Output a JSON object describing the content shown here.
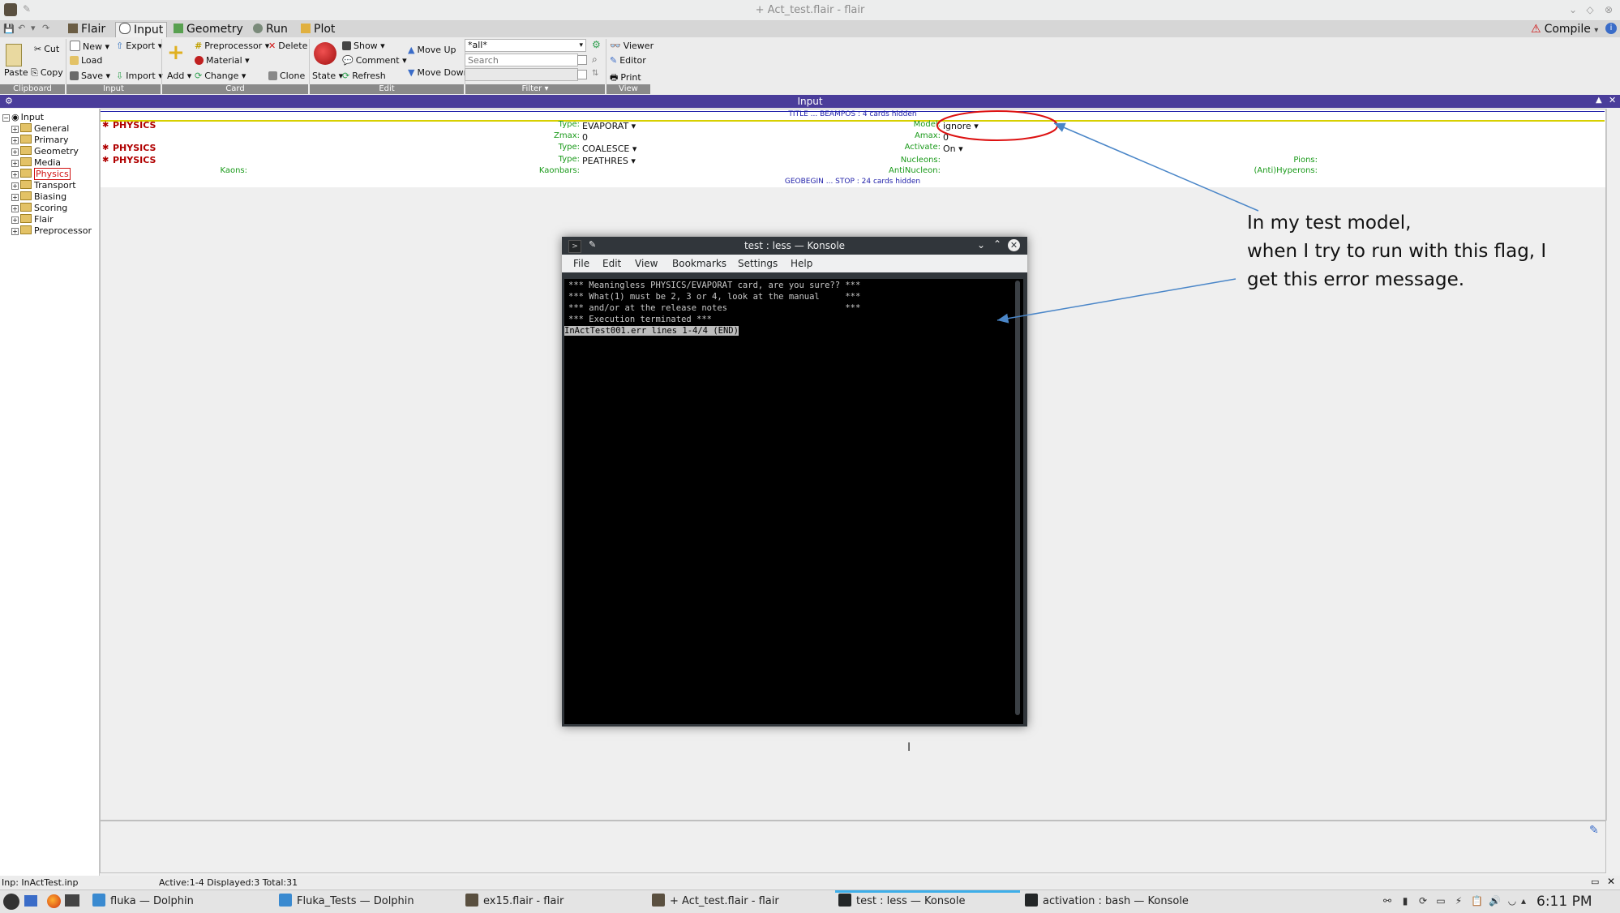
{
  "window": {
    "title": "+ Act_test.flair - flair"
  },
  "tabs": [
    {
      "label": "Flair",
      "active": false
    },
    {
      "label": "Input",
      "active": true
    },
    {
      "label": "Geometry",
      "active": false
    },
    {
      "label": "Run",
      "active": false
    },
    {
      "label": "Plot",
      "active": false
    }
  ],
  "compile_label": "Compile",
  "ribbon": {
    "clipboard": {
      "paste": "Paste",
      "cut": "Cut",
      "copy": "Copy",
      "group": "Clipboard"
    },
    "input": {
      "new": "New",
      "load": "Load",
      "save": "Save",
      "export": "Export",
      "import": "Import",
      "group": "Input"
    },
    "card": {
      "add": "Add",
      "preprocessor": "Preprocessor",
      "material": "Material",
      "change": "Change",
      "delete": "Delete",
      "clone": "Clone",
      "group": "Card"
    },
    "edit": {
      "state": "State",
      "show": "Show",
      "comment": "Comment",
      "refresh": "Refresh",
      "move_up": "Move Up",
      "move_down": "Move Down",
      "group": "Edit"
    },
    "filter": {
      "select_value": "*all*",
      "search_placeholder": "Search",
      "group": "Filter"
    },
    "view": {
      "viewer": "Viewer",
      "editor": "Editor",
      "print": "Print",
      "group": "View"
    }
  },
  "panel_title": "Input",
  "tree": {
    "root": "Input",
    "items": [
      "General",
      "Primary",
      "Geometry",
      "Media",
      "Physics",
      "Transport",
      "Biasing",
      "Scoring",
      "Flair",
      "Preprocessor"
    ],
    "selected": "Physics"
  },
  "cards": {
    "hidden_top": "TITLE ... BEAMPOS : 4 cards hidden",
    "hidden_bottom": "GEOBEGIN ... STOP : 24 cards hidden",
    "rows": [
      {
        "keyword": "PHYSICS",
        "type_label": "Type:",
        "type_value": "EVAPORAT ▾",
        "f2_label": "Model:",
        "f2_value": "ignore ▾",
        "sub": {
          "zmax_label": "Zmax:",
          "zmax_value": "0",
          "amax_label": "Amax:",
          "amax_value": "0"
        }
      },
      {
        "keyword": "PHYSICS",
        "type_label": "Type:",
        "type_value": "COALESCE ▾",
        "f2_label": "Activate:",
        "f2_value": "On ▾"
      },
      {
        "keyword": "PHYSICS",
        "type_label": "Type:",
        "type_value": "PEATHRES ▾",
        "nucleons": "Nucleons:",
        "pions": "Pions:",
        "kaons": "Kaons:",
        "kaonbars": "Kaonbars:",
        "antinucleon": "AntiNucleon:",
        "hyperons": "(Anti)Hyperons:"
      }
    ]
  },
  "status": {
    "file": "Inp: InActTest.inp",
    "summary": "Active:1-4  Displayed:3 Total:31"
  },
  "konsole": {
    "title": "test : less — Konsole",
    "menu": [
      "File",
      "Edit",
      "View",
      "Bookmarks",
      "Settings",
      "Help"
    ],
    "lines": [
      "*** Meaningless PHYSICS/EVAPORAT card, are you sure?? ***",
      "*** What(1) must be 2, 3 or 4, look at the manual     ***",
      "*** and/or at the release notes                       ***",
      "*** Execution terminated ***"
    ],
    "prompt": "InActTest001.err lines 1-4/4 (END)"
  },
  "annotation": {
    "line1": "In my test model,",
    "line2": "when I try to run with this flag, I",
    "line3": "get this error message."
  },
  "taskbar": {
    "tasks": [
      "fluka — Dolphin",
      "Fluka_Tests — Dolphin",
      "ex15.flair - flair",
      "+ Act_test.flair - flair",
      "test : less — Konsole",
      "activation : bash — Konsole"
    ],
    "clock": "6:11 PM"
  },
  "colors": {
    "accent": "#4a3d9a",
    "keyword": "#b00000",
    "label": "#1a9a1a",
    "annotation_ellipse": "#dd1111",
    "annotation_arrow": "#4a86c8"
  }
}
